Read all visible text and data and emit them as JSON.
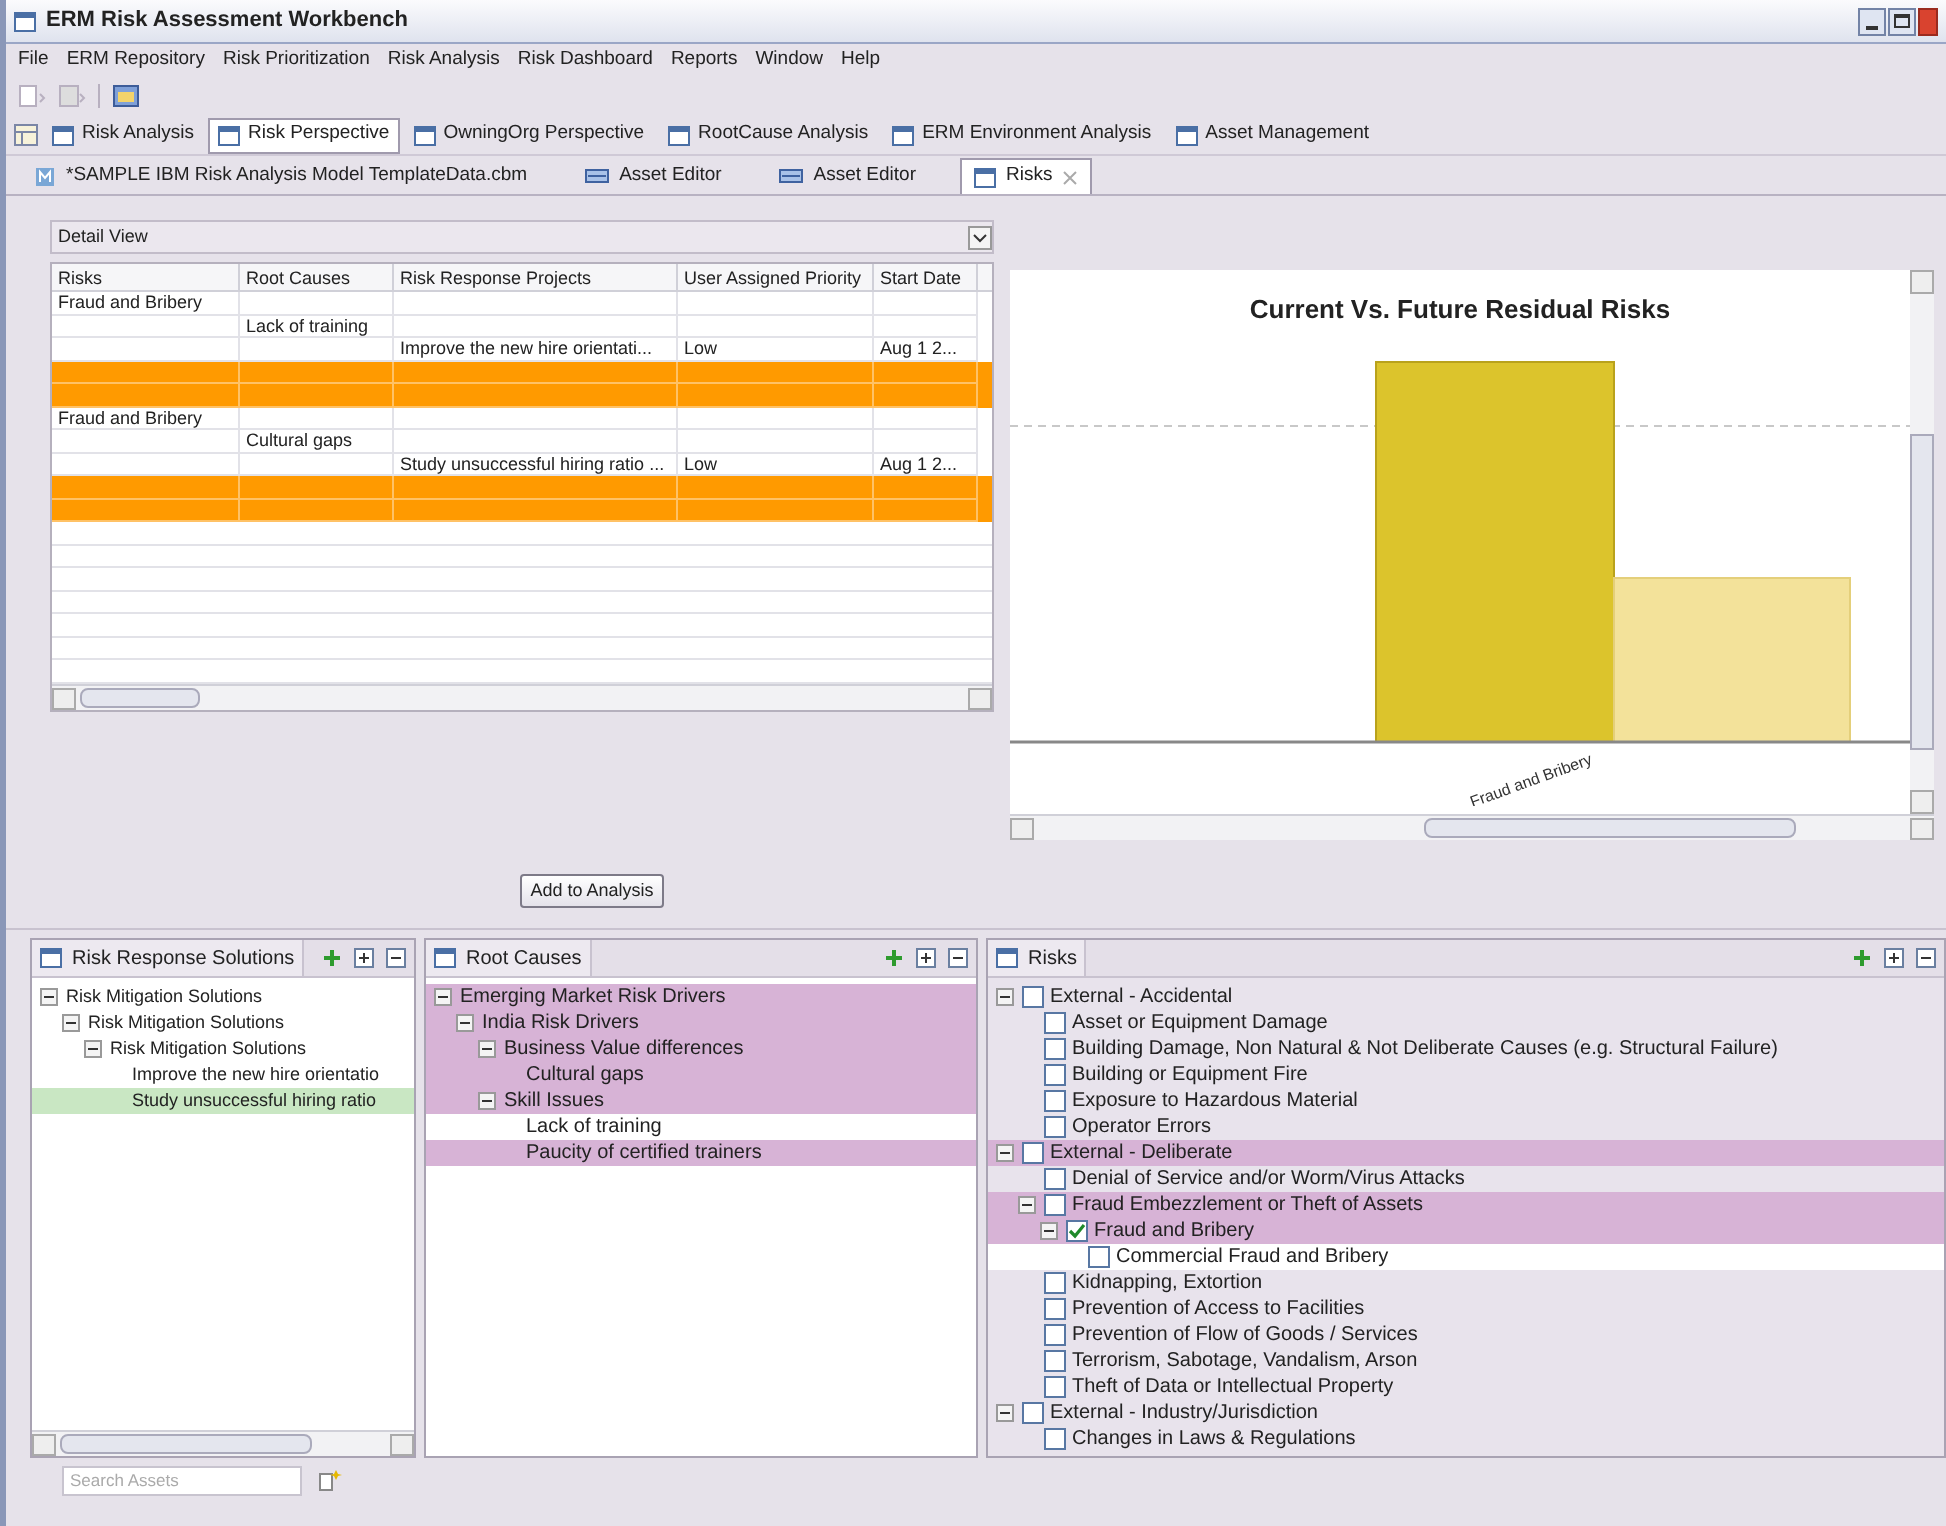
{
  "window": {
    "title": "ERM Risk Assessment Workbench"
  },
  "menu": [
    "File",
    "ERM Repository",
    "Risk Prioritization",
    "Risk Analysis",
    "Risk Dashboard",
    "Reports",
    "Window",
    "Help"
  ],
  "perspectives": [
    {
      "label": "Risk Analysis",
      "selected": false
    },
    {
      "label": "Risk Perspective",
      "selected": true
    },
    {
      "label": "OwningOrg Perspective",
      "selected": false
    },
    {
      "label": "RootCause Analysis",
      "selected": false
    },
    {
      "label": "ERM Environment Analysis",
      "selected": false
    },
    {
      "label": "Asset Management",
      "selected": false
    }
  ],
  "editor_tabs": [
    {
      "label": "*SAMPLE IBM Risk Analysis Model TemplateData.cbm",
      "kind": "model",
      "selected": false
    },
    {
      "label": "Asset Editor",
      "kind": "editor",
      "selected": false
    },
    {
      "label": "Asset Editor",
      "kind": "editor",
      "selected": false
    },
    {
      "label": "Risks",
      "kind": "view",
      "selected": true
    }
  ],
  "view_selector": {
    "value": "Detail View"
  },
  "table": {
    "columns": [
      "Risks",
      "Root Causes",
      "Risk Response Projects",
      "User Assigned Priority",
      "Start Date"
    ],
    "rows": [
      {
        "kind": "risk",
        "text": "Fraud and Bribery"
      },
      {
        "kind": "root_cause",
        "text": "Lack of training"
      },
      {
        "kind": "project",
        "project": "Improve the new hire orientati...",
        "priority": "Low",
        "start_date": "Aug 1 2..."
      },
      {
        "kind": "highlight"
      },
      {
        "kind": "highlight"
      },
      {
        "kind": "risk",
        "text": "Fraud and Bribery"
      },
      {
        "kind": "root_cause",
        "text": "Cultural gaps"
      },
      {
        "kind": "project",
        "project": "Study unsuccessful hiring ratio ...",
        "priority": "Low",
        "start_date": "Aug 1 2..."
      },
      {
        "kind": "highlight"
      },
      {
        "kind": "highlight"
      }
    ]
  },
  "chart": {
    "title": "Current Vs. Future Residual Risks",
    "category": "Fraud and Bribery"
  },
  "add_button": "Add to Analysis",
  "panels": [
    {
      "title": "Risk Response Solutions",
      "kind": "solutions",
      "tree": [
        {
          "label": "Risk Mitigation Solutions",
          "selected": false,
          "expanded": true,
          "children": [
            {
              "label": "Risk Mitigation Solutions",
              "selected": false,
              "expanded": true,
              "children": [
                {
                  "label": "Risk Mitigation Solutions",
                  "selected": false,
                  "expanded": true,
                  "children": [
                    {
                      "label": "Improve the new hire orientatio",
                      "selected": false
                    },
                    {
                      "label": "Study unsuccessful hiring ratio",
                      "selected": true
                    }
                  ]
                }
              ]
            }
          ]
        }
      ]
    },
    {
      "title": "Root Causes",
      "kind": "causes",
      "tree": [
        {
          "label": "Emerging Market Risk Drivers",
          "selected": true,
          "expanded": true,
          "children": [
            {
              "label": "India Risk Drivers",
              "selected": true,
              "expanded": true,
              "children": [
                {
                  "label": "Business Value differences",
                  "selected": true,
                  "expanded": true,
                  "children": [
                    {
                      "label": "Cultural gaps",
                      "selected": true
                    }
                  ]
                },
                {
                  "label": "Skill Issues",
                  "selected": true,
                  "expanded": true,
                  "children": [
                    {
                      "label": "Lack of training",
                      "selected": false
                    },
                    {
                      "label": "Paucity of certified trainers",
                      "selected": true
                    }
                  ]
                }
              ]
            }
          ]
        }
      ]
    },
    {
      "title": "Risks",
      "kind": "checklist",
      "tree": [
        {
          "label": "External - Accidental",
          "selected": false,
          "hovered": false,
          "checked": false,
          "expanded": true,
          "children": [
            {
              "label": "Asset or Equipment Damage",
              "selected": false,
              "hovered": false,
              "checked": false
            },
            {
              "label": "Building Damage, Non Natural & Not Deliberate Causes (e.g. Structural Failure)",
              "selected": false,
              "hovered": false,
              "checked": false
            },
            {
              "label": "Building or Equipment Fire",
              "selected": false,
              "hovered": false,
              "checked": false
            },
            {
              "label": "Exposure to Hazardous Material",
              "selected": false,
              "hovered": false,
              "checked": false
            },
            {
              "label": "Operator Errors",
              "selected": false,
              "hovered": false,
              "checked": false
            }
          ]
        },
        {
          "label": "External - Deliberate",
          "selected": true,
          "hovered": false,
          "checked": false,
          "expanded": true,
          "children": [
            {
              "label": "Denial of Service and/or Worm/Virus Attacks",
              "selected": false,
              "hovered": false,
              "checked": false
            },
            {
              "label": "Fraud Embezzlement or Theft of Assets",
              "selected": true,
              "hovered": false,
              "checked": false,
              "expanded": true,
              "children": [
                {
                  "label": "Fraud and Bribery",
                  "selected": true,
                  "hovered": false,
                  "checked": true,
                  "expanded": true,
                  "children": [
                    {
                      "label": "Commercial Fraud and Bribery",
                      "selected": false,
                      "hovered": true,
                      "checked": false
                    }
                  ]
                }
              ]
            },
            {
              "label": "Kidnapping, Extortion",
              "selected": false,
              "hovered": false,
              "checked": false
            },
            {
              "label": "Prevention of Access to Facilities",
              "selected": false,
              "hovered": false,
              "checked": false
            },
            {
              "label": "Prevention of Flow of Goods / Services",
              "selected": false,
              "hovered": false,
              "checked": false
            },
            {
              "label": "Terrorism, Sabotage, Vandalism, Arson",
              "selected": false,
              "hovered": false,
              "checked": false
            },
            {
              "label": "Theft of Data or Intellectual Property",
              "selected": false,
              "hovered": false,
              "checked": false
            }
          ]
        },
        {
          "label": "External - Industry/Jurisdiction",
          "selected": false,
          "hovered": false,
          "checked": false,
          "expanded": true,
          "children": [
            {
              "label": "Changes in Laws & Regulations",
              "selected": false,
              "hovered": false,
              "checked": false
            }
          ]
        }
      ]
    }
  ],
  "search": {
    "placeholder": "Search Assets"
  }
}
